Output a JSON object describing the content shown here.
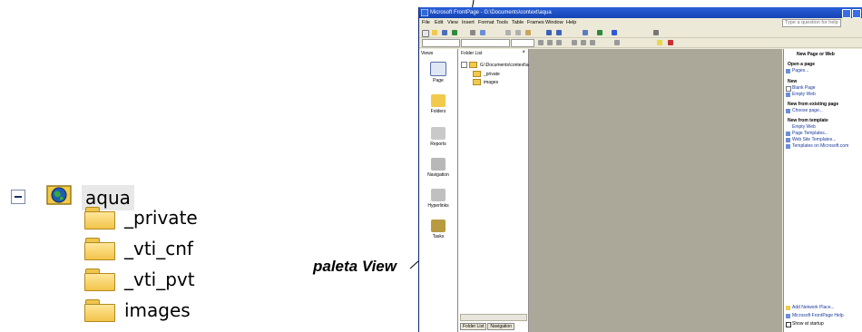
{
  "tree": {
    "root_label": "aqua",
    "children": [
      "_private",
      "_vti_cnf",
      "_vti_pvt",
      "images"
    ]
  },
  "annotation": {
    "label": "paleta View"
  },
  "window": {
    "title": "Microsoft FrontPage - G:\\Documents\\context\\aqua",
    "menu": [
      "File",
      "Edit",
      "View",
      "Insert",
      "Format",
      "Tools",
      "Table",
      "Frames",
      "Window",
      "Help"
    ],
    "help_placeholder": "Type a question for help"
  },
  "views_bar": {
    "title": "Views",
    "items": [
      "Page",
      "Folders",
      "Reports",
      "Navigation",
      "Hyperlinks",
      "Tasks"
    ]
  },
  "folder_list": {
    "title": "Folder List",
    "root": "G:\\Documents\\context\\aqua",
    "items": [
      "_private",
      "images"
    ],
    "tabs": [
      "Folder List",
      "Navigation"
    ]
  },
  "task_pane": {
    "title": "New Page or Web",
    "sections": [
      {
        "heading": "Open a page",
        "links": [
          "Pages..."
        ]
      },
      {
        "heading": "New",
        "links": [
          "Blank Page",
          "Empty Web"
        ]
      },
      {
        "heading": "New from existing page",
        "links": [
          "Choose page..."
        ]
      },
      {
        "heading": "New from template",
        "links": [
          "Empty Web",
          "Page Templates...",
          "Web Site Templates...",
          "Templates on Microsoft.com"
        ]
      }
    ],
    "footer": [
      "Add Network Place...",
      "Microsoft FrontPage Help",
      "Show at startup"
    ]
  },
  "colors": {
    "titlebar": "#1544b4",
    "workspace": "#aca899",
    "chrome": "#ece9d8"
  }
}
